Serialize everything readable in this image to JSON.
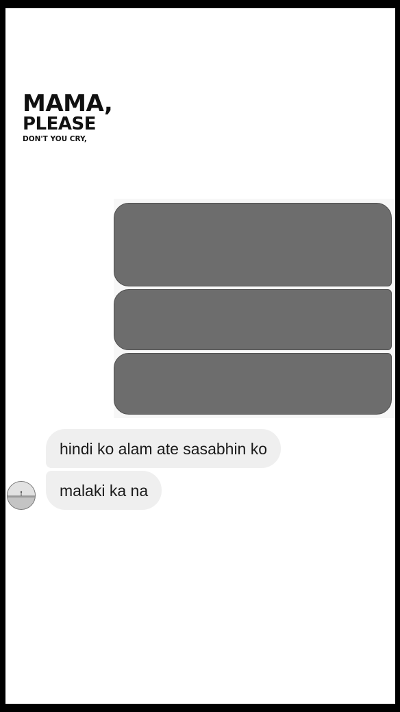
{
  "header": {
    "title_line1": "MAMA,",
    "title_line2": "PLEASE",
    "title_line3": "DON'T YOU CRY,"
  },
  "messages": {
    "outgoing": [
      {
        "state": "redacted"
      },
      {
        "state": "redacted"
      },
      {
        "state": "redacted"
      }
    ],
    "incoming": [
      {
        "text": "hindi ko alam ate sasabhin ko"
      },
      {
        "text": "malaki ka na"
      }
    ]
  },
  "colors": {
    "frame": "#000000",
    "background": "#ffffff",
    "outgoing_bubble": "#6d6d6d",
    "incoming_bubble": "#efefef",
    "text": "#1a1a1a"
  },
  "icons": {
    "avatar": "sender-avatar-icon"
  }
}
